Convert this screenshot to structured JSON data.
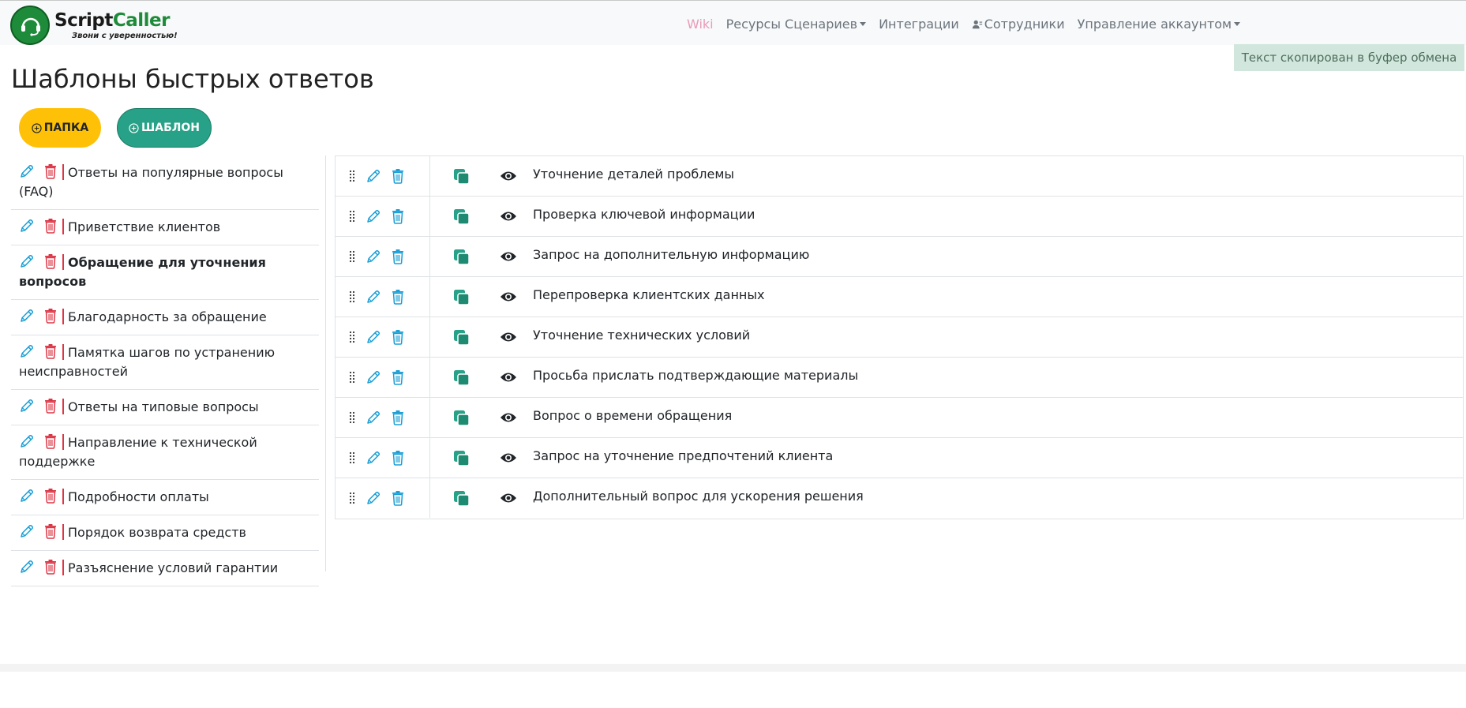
{
  "app": {
    "logo_main_1": "Script",
    "logo_main_2": "Caller",
    "logo_tagline": "Звони с уверенностью!"
  },
  "nav": {
    "wiki": "Wiki",
    "resources": "Ресурсы Сценариев",
    "integrations": "Интеграции",
    "employees": "Сотрудники",
    "account": "Управление аккаунтом"
  },
  "toast": "Текст скопирован в буфер обмена",
  "page_title": "Шаблоны быстрых ответов",
  "buttons": {
    "folder": "ПАПКА",
    "template": "ШАБЛОН"
  },
  "folders": [
    "Ответы на популярные вопросы (FAQ)",
    "Приветствие клиентов",
    "Обращение для уточнения вопросов",
    "Благодарность за обращение",
    "Памятка шагов по устранению неисправностей",
    "Ответы на типовые вопросы",
    "Направление к технической поддержке",
    "Подробности оплаты",
    "Порядок возврата средств",
    "Разъяснение условий гарантии"
  ],
  "active_folder_index": 2,
  "templates": [
    "Уточнение деталей проблемы",
    "Проверка ключевой информации",
    "Запрос на дополнительную информацию",
    "Перепроверка клиентских данных",
    "Уточнение технических условий",
    "Просьба прислать подтверждающие материалы",
    "Вопрос о времени обращения",
    "Запрос на уточнение предпочтений клиента",
    "Дополнительный вопрос для ускорения решения"
  ],
  "colors": {
    "brand_green": "#1e8b3a",
    "folder_button": "#ffc107",
    "template_button": "#27a187",
    "edit_icon": "#1a9fd6",
    "folder_trash": "#dc3545",
    "template_trash": "#1a9fd6",
    "copy_icon": "#27a187",
    "toast_bg": "#d1e7dd"
  }
}
